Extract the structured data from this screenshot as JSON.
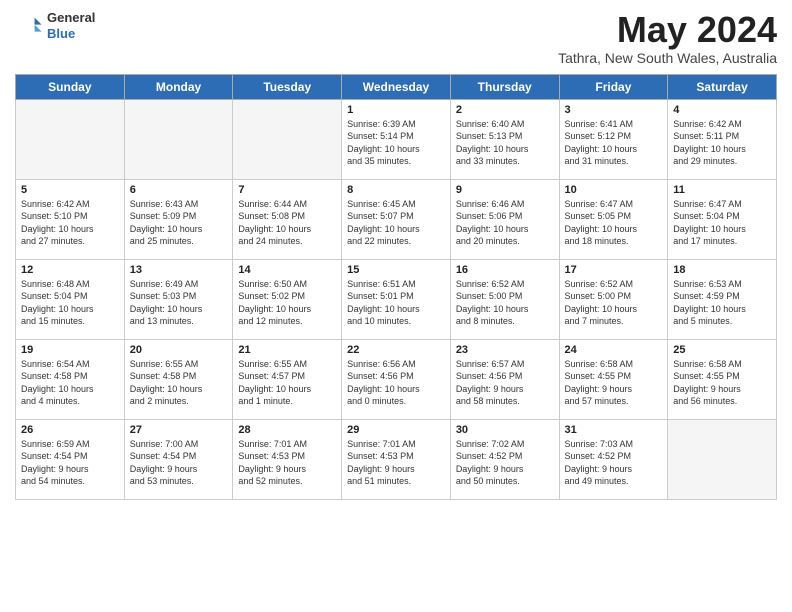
{
  "header": {
    "logo_general": "General",
    "logo_blue": "Blue",
    "month_title": "May 2024",
    "subtitle": "Tathra, New South Wales, Australia"
  },
  "days": [
    "Sunday",
    "Monday",
    "Tuesday",
    "Wednesday",
    "Thursday",
    "Friday",
    "Saturday"
  ],
  "weeks": [
    [
      {
        "num": "",
        "text": ""
      },
      {
        "num": "",
        "text": ""
      },
      {
        "num": "",
        "text": ""
      },
      {
        "num": "1",
        "text": "Sunrise: 6:39 AM\nSunset: 5:14 PM\nDaylight: 10 hours\nand 35 minutes."
      },
      {
        "num": "2",
        "text": "Sunrise: 6:40 AM\nSunset: 5:13 PM\nDaylight: 10 hours\nand 33 minutes."
      },
      {
        "num": "3",
        "text": "Sunrise: 6:41 AM\nSunset: 5:12 PM\nDaylight: 10 hours\nand 31 minutes."
      },
      {
        "num": "4",
        "text": "Sunrise: 6:42 AM\nSunset: 5:11 PM\nDaylight: 10 hours\nand 29 minutes."
      }
    ],
    [
      {
        "num": "5",
        "text": "Sunrise: 6:42 AM\nSunset: 5:10 PM\nDaylight: 10 hours\nand 27 minutes."
      },
      {
        "num": "6",
        "text": "Sunrise: 6:43 AM\nSunset: 5:09 PM\nDaylight: 10 hours\nand 25 minutes."
      },
      {
        "num": "7",
        "text": "Sunrise: 6:44 AM\nSunset: 5:08 PM\nDaylight: 10 hours\nand 24 minutes."
      },
      {
        "num": "8",
        "text": "Sunrise: 6:45 AM\nSunset: 5:07 PM\nDaylight: 10 hours\nand 22 minutes."
      },
      {
        "num": "9",
        "text": "Sunrise: 6:46 AM\nSunset: 5:06 PM\nDaylight: 10 hours\nand 20 minutes."
      },
      {
        "num": "10",
        "text": "Sunrise: 6:47 AM\nSunset: 5:05 PM\nDaylight: 10 hours\nand 18 minutes."
      },
      {
        "num": "11",
        "text": "Sunrise: 6:47 AM\nSunset: 5:04 PM\nDaylight: 10 hours\nand 17 minutes."
      }
    ],
    [
      {
        "num": "12",
        "text": "Sunrise: 6:48 AM\nSunset: 5:04 PM\nDaylight: 10 hours\nand 15 minutes."
      },
      {
        "num": "13",
        "text": "Sunrise: 6:49 AM\nSunset: 5:03 PM\nDaylight: 10 hours\nand 13 minutes."
      },
      {
        "num": "14",
        "text": "Sunrise: 6:50 AM\nSunset: 5:02 PM\nDaylight: 10 hours\nand 12 minutes."
      },
      {
        "num": "15",
        "text": "Sunrise: 6:51 AM\nSunset: 5:01 PM\nDaylight: 10 hours\nand 10 minutes."
      },
      {
        "num": "16",
        "text": "Sunrise: 6:52 AM\nSunset: 5:00 PM\nDaylight: 10 hours\nand 8 minutes."
      },
      {
        "num": "17",
        "text": "Sunrise: 6:52 AM\nSunset: 5:00 PM\nDaylight: 10 hours\nand 7 minutes."
      },
      {
        "num": "18",
        "text": "Sunrise: 6:53 AM\nSunset: 4:59 PM\nDaylight: 10 hours\nand 5 minutes."
      }
    ],
    [
      {
        "num": "19",
        "text": "Sunrise: 6:54 AM\nSunset: 4:58 PM\nDaylight: 10 hours\nand 4 minutes."
      },
      {
        "num": "20",
        "text": "Sunrise: 6:55 AM\nSunset: 4:58 PM\nDaylight: 10 hours\nand 2 minutes."
      },
      {
        "num": "21",
        "text": "Sunrise: 6:55 AM\nSunset: 4:57 PM\nDaylight: 10 hours\nand 1 minute."
      },
      {
        "num": "22",
        "text": "Sunrise: 6:56 AM\nSunset: 4:56 PM\nDaylight: 10 hours\nand 0 minutes."
      },
      {
        "num": "23",
        "text": "Sunrise: 6:57 AM\nSunset: 4:56 PM\nDaylight: 9 hours\nand 58 minutes."
      },
      {
        "num": "24",
        "text": "Sunrise: 6:58 AM\nSunset: 4:55 PM\nDaylight: 9 hours\nand 57 minutes."
      },
      {
        "num": "25",
        "text": "Sunrise: 6:58 AM\nSunset: 4:55 PM\nDaylight: 9 hours\nand 56 minutes."
      }
    ],
    [
      {
        "num": "26",
        "text": "Sunrise: 6:59 AM\nSunset: 4:54 PM\nDaylight: 9 hours\nand 54 minutes."
      },
      {
        "num": "27",
        "text": "Sunrise: 7:00 AM\nSunset: 4:54 PM\nDaylight: 9 hours\nand 53 minutes."
      },
      {
        "num": "28",
        "text": "Sunrise: 7:01 AM\nSunset: 4:53 PM\nDaylight: 9 hours\nand 52 minutes."
      },
      {
        "num": "29",
        "text": "Sunrise: 7:01 AM\nSunset: 4:53 PM\nDaylight: 9 hours\nand 51 minutes."
      },
      {
        "num": "30",
        "text": "Sunrise: 7:02 AM\nSunset: 4:52 PM\nDaylight: 9 hours\nand 50 minutes."
      },
      {
        "num": "31",
        "text": "Sunrise: 7:03 AM\nSunset: 4:52 PM\nDaylight: 9 hours\nand 49 minutes."
      },
      {
        "num": "",
        "text": ""
      }
    ]
  ]
}
